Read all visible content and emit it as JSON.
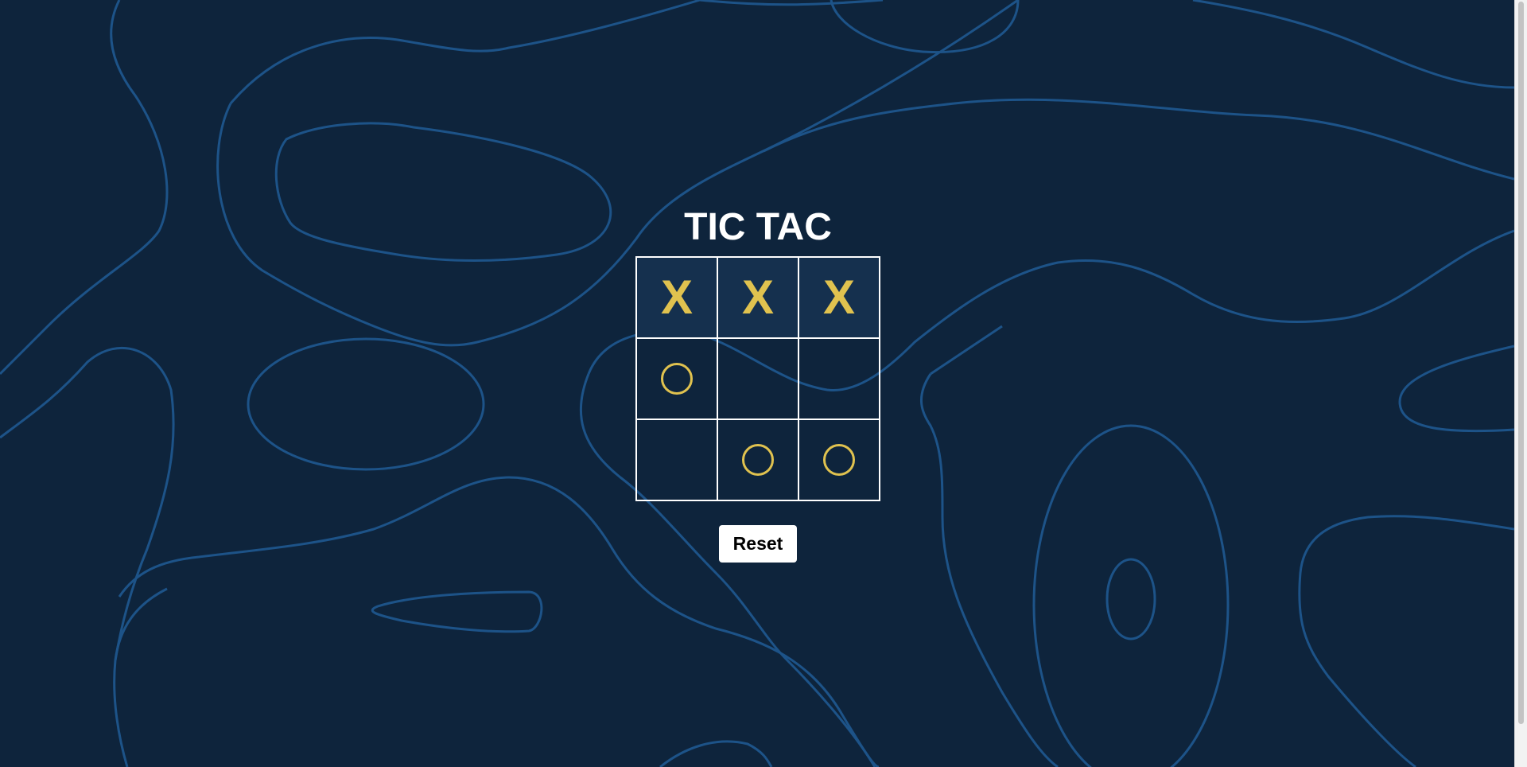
{
  "game": {
    "title": "TIC TAC",
    "reset_label": "Reset"
  },
  "board": {
    "cells": [
      "X",
      "X",
      "X",
      "O",
      "",
      "",
      "",
      "O",
      "O"
    ],
    "winning_line": [
      0,
      1,
      2
    ]
  },
  "colors": {
    "background": "#0e243c",
    "contour_lines": "#1d5388",
    "marks": "#e0c24f",
    "winning_cell": "#15304e",
    "grid_lines": "#ffffff"
  }
}
